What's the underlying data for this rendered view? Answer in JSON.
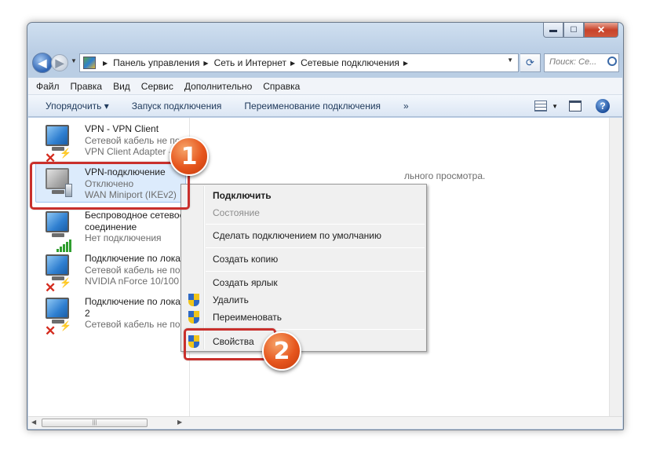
{
  "window": {
    "caption_buttons": {
      "minimize": "▬",
      "maximize": "☐",
      "close": "✕"
    }
  },
  "address": {
    "crumbs": [
      "Панель управления",
      "Сеть и Интернет",
      "Сетевые подключения"
    ],
    "search_placeholder": "Поиск: Се..."
  },
  "menubar": [
    "Файл",
    "Правка",
    "Вид",
    "Сервис",
    "Дополнительно",
    "Справка"
  ],
  "toolbar": {
    "organize": "Упорядочить ▾",
    "start": "Запуск подключения",
    "rename": "Переименование подключения",
    "more": "»",
    "help": "?"
  },
  "connections": [
    {
      "name": "VPN - VPN Client",
      "line2": "Сетевой кабель не по",
      "line3": "VPN Client Adapter - ",
      "icon": "disconnected-cable"
    },
    {
      "name": "VPN-подключение",
      "line2": "Отключено",
      "line3": "WAN Miniport (IKEv2)",
      "icon": "vpn-gray"
    },
    {
      "name": "Беспроводное сетевое",
      "line2": "соединение",
      "line3": "Нет подключения",
      "icon": "wireless"
    },
    {
      "name": "Подключение по лока",
      "line2": "Сетевой кабель не по",
      "line3": "NVIDIA nForce 10/100 M",
      "icon": "disconnected-cable"
    },
    {
      "name": "Подключение по лока",
      "line2": "2",
      "line3": "Сетевой кабель не по",
      "icon": "disconnected-cable"
    }
  ],
  "preview_message": "льного просмотра.",
  "context_menu": {
    "connect": "Подключить",
    "status": "Состояние",
    "set_default": "Сделать подключением по умолчанию",
    "create_copy": "Создать копию",
    "create_shortcut": "Создать ярлык",
    "delete": "Удалить",
    "rename": "Переименовать",
    "properties": "Свойства"
  },
  "callouts": {
    "first": "1",
    "second": "2"
  },
  "colors": {
    "callout": "#e6551d",
    "highlight": "#c9302c",
    "selection": "#dcebfc"
  }
}
